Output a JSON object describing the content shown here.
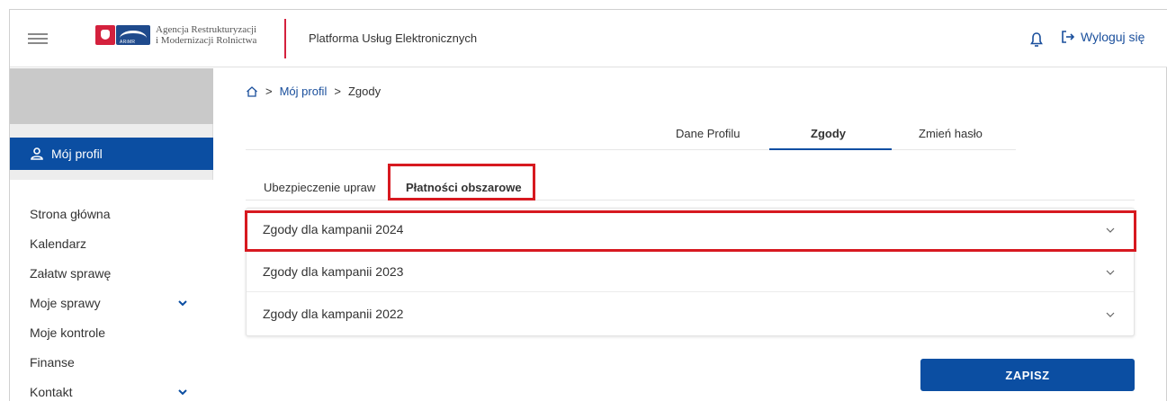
{
  "header": {
    "agency_line1": "Agencja Restrukturyzacji",
    "agency_line2": "i Modernizacji Rolnictwa",
    "logo_badge": "ARiMR",
    "platform_title": "Platforma Usług Elektronicznych",
    "logout_label": "Wyloguj się",
    "brand_color": "#0b4ea2",
    "accent_red": "#d4213d"
  },
  "sidebar": {
    "profile_label": "Mój profil",
    "items": [
      {
        "label": "Strona główna"
      },
      {
        "label": "Kalendarz"
      },
      {
        "label": "Załatw sprawę"
      },
      {
        "label": "Moje sprawy",
        "expandable": true
      },
      {
        "label": "Moje kontrole"
      },
      {
        "label": "Finanse"
      },
      {
        "label": "Kontakt",
        "expandable": true
      }
    ]
  },
  "breadcrumb": {
    "sep": ">",
    "items": [
      "Mój profil",
      "Zgody"
    ]
  },
  "tabs": [
    {
      "label": "Dane Profilu",
      "active": false
    },
    {
      "label": "Zgody",
      "active": true
    },
    {
      "label": "Zmień hasło",
      "active": false
    }
  ],
  "subtabs": [
    {
      "label": "Ubezpieczenie upraw",
      "active": false
    },
    {
      "label": "Płatności obszarowe",
      "active": true
    }
  ],
  "accordion": [
    {
      "label": "Zgody dla kampanii 2024",
      "highlighted": true
    },
    {
      "label": "Zgody dla kampanii 2023"
    },
    {
      "label": "Zgody dla kampanii 2022"
    }
  ],
  "actions": {
    "save_label": "ZAPISZ"
  }
}
